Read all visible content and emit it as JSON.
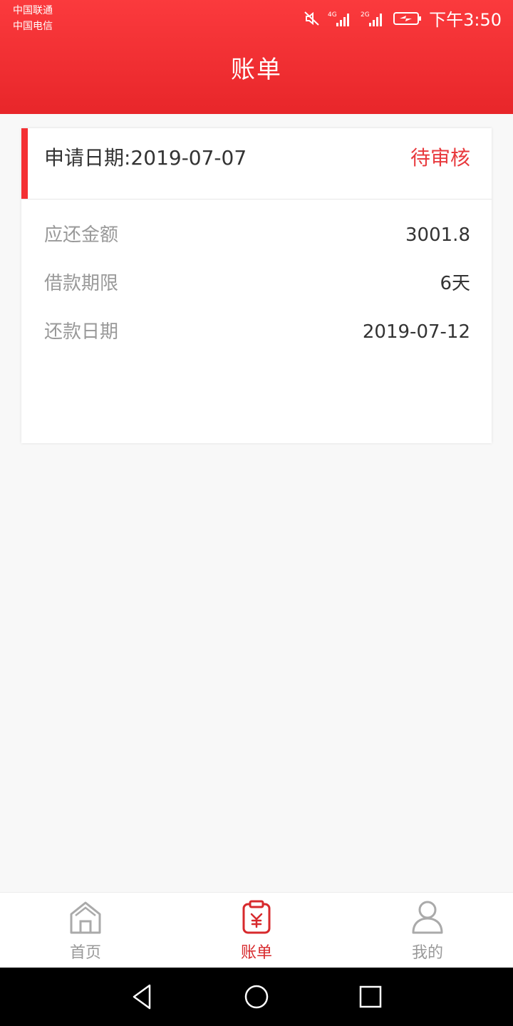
{
  "status_bar": {
    "carrier1": "中国联通",
    "carrier2": "中国电信",
    "net1": "4G",
    "net2": "2G",
    "time": "下午3:50"
  },
  "header": {
    "title": "账单"
  },
  "bill": {
    "apply_date_text": "申请日期:2019-07-07",
    "status": "待审核",
    "rows": [
      {
        "label": "应还金额",
        "value": "3001.8"
      },
      {
        "label": "借款期限",
        "value": "6天"
      },
      {
        "label": "还款日期",
        "value": "2019-07-12"
      }
    ]
  },
  "tabs": [
    {
      "label": "首页",
      "icon": "home-icon",
      "active": false
    },
    {
      "label": "账单",
      "icon": "bill-icon",
      "active": true
    },
    {
      "label": "我的",
      "icon": "user-icon",
      "active": false
    }
  ],
  "colors": {
    "brand_red": "#e8262a",
    "status_red": "#e8393d",
    "tab_active": "#d7292c",
    "tab_inactive": "#999999"
  }
}
